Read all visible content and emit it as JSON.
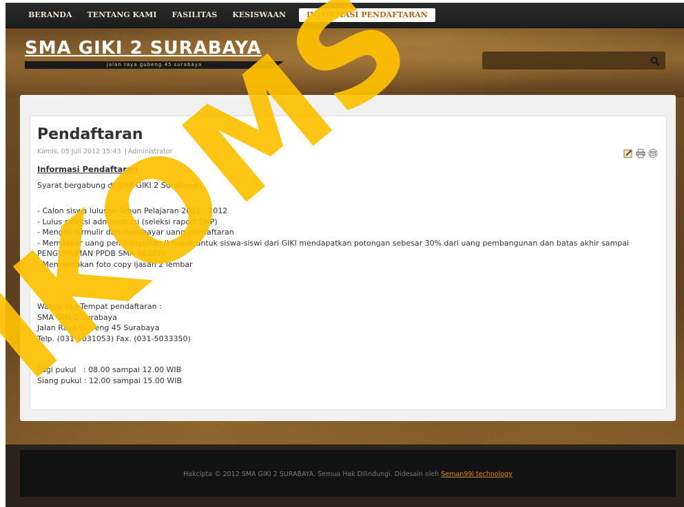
{
  "nav": {
    "items": [
      "BERANDA",
      "TENTANG KAMI",
      "FASILITAS",
      "KESISWAAN",
      "INFORMASI PENDAFTARAN"
    ],
    "active_index": 4
  },
  "header": {
    "site_title": "SMA GIKI 2 SURABAYA",
    "tagline": "jalan raya gubeng 45 surabaya",
    "search_placeholder": ""
  },
  "article": {
    "title": "Pendaftaran",
    "date": "Kamis, 05 Juli 2012 15:43",
    "separator": "|",
    "author": "Administrator",
    "icons": [
      "edit-icon",
      "print-icon",
      "email-icon"
    ],
    "subheading": "Informasi Pendaftaran",
    "intro": "Syarat bergabung di SMA GIKI 2 Surabaya :",
    "requirements": [
      "- Calon siswa lulusan Tahun Pelajaran 2011 - 2012",
      "- Lulus seleksi administrasi (seleksi raport SMP)",
      "- Mengisi formulir dan membayar uang pendaftaran",
      "- Membayar uang pembangunan (khusus untuk siswa-siswi dari GIKI mendapatkan potongan sebesar 30% dari uang pembangunan dan batas akhir sampai PENGUMUMAN PPDB SMA NEGERI",
      "- Menyerahkan foto copy ijasah 2 lembar"
    ],
    "place_heading": "Waktu dan Tempat pendaftaran :",
    "place_lines": [
      "SMA GIKI  2 Surabaya",
      "Jalan Raya Gubeng 45 Surabaya",
      "Telp. (031-5031053) Fax. (031-5033350)"
    ],
    "schedule": [
      "Pagi pukul   : 08.00 sampai 12.00 WIB",
      "Siang pukul : 12.00 sampai 15.00 WIB"
    ]
  },
  "footer": {
    "text": "Hakcipta © 2012 SMA GIKI 2 SURABAYA. Semua Hak Dilindungi. Didesain oleh ",
    "link": "Seman99i technology"
  },
  "colors": {
    "accent": "#b5651d",
    "footer_link": "#e08a1a",
    "watermark": "#ffc000"
  }
}
